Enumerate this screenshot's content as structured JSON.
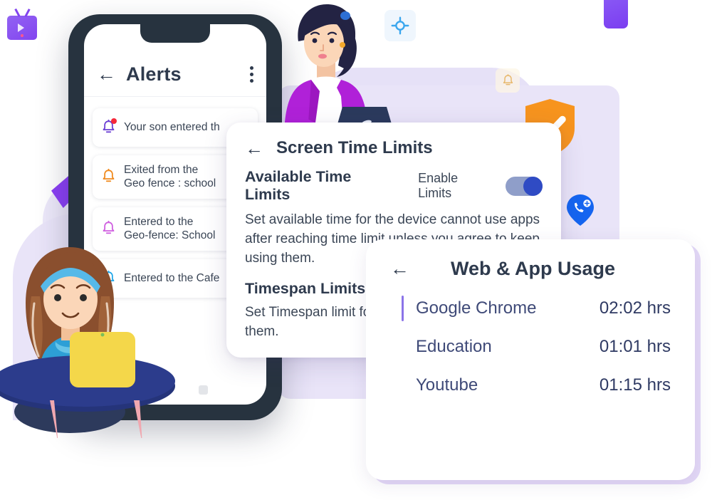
{
  "colors": {
    "dark_text": "#2e3a4d",
    "lavender_bg": "#e9e4f8",
    "purple_accent": "#8b3ff5",
    "shield_orange": "#f7941e",
    "toggle_on": "#2f4bc4",
    "usage_name": "#3f4a78"
  },
  "phone": {
    "appbar": {
      "back_icon": "arrow-left-icon",
      "title": "Alerts",
      "menu_icon": "kebab-menu-icon"
    },
    "alerts": [
      {
        "icon": "bell-icon",
        "icon_color": "#6b3fd4",
        "has_badge": true,
        "text": "Your son entered th"
      },
      {
        "icon": "bell-icon",
        "icon_color": "#f08a1e",
        "has_badge": false,
        "text": "Exited from the\nGeo fence : school"
      },
      {
        "icon": "bell-icon",
        "icon_color": "#cf5fe0",
        "has_badge": false,
        "text": "Entered to the\nGeo-fence: School"
      },
      {
        "icon": "bell-icon",
        "icon_color": "#22a7e8",
        "has_badge": false,
        "text": "Entered to the Cafe"
      }
    ],
    "home_indicators": [
      "circle",
      "square"
    ]
  },
  "screen_time_card": {
    "back_icon": "arrow-left-icon",
    "title": "Screen Time Limits",
    "available_heading": "Available Time Limits",
    "enable_label": "Enable Limits",
    "toggle_state": "on",
    "available_body": "Set available time for the device cannot use apps after reaching time limit unless you agree to keep using them.",
    "timespan_heading": "Timespan Limits",
    "timespan_body": "Set Timespan limit for during the timespan using them."
  },
  "web_app_usage_card": {
    "back_icon": "arrow-left-icon",
    "title": "Web & App Usage",
    "rows": [
      {
        "name": "Google Chrome",
        "time": "02:02 hrs",
        "highlighted": true
      },
      {
        "name": "Education",
        "time": "01:01 hrs",
        "highlighted": false
      },
      {
        "name": "Youtube",
        "time": "01:15 hrs",
        "highlighted": false
      }
    ]
  },
  "decorations": {
    "gps_badge_icon": "gps-target-icon",
    "bell_badge_icon": "bell-icon",
    "shield_icon": "shield-check-icon",
    "call_pin_icon": "call-location-pin-icon",
    "tv_icon": "tv-play-icon",
    "chip_icon": "purple-chip-shape",
    "shard_icon": "purple-shard-shape",
    "woman_illustration": "woman-with-laptop-illustration",
    "girl_illustration": "girl-at-table-with-laptop-illustration"
  }
}
